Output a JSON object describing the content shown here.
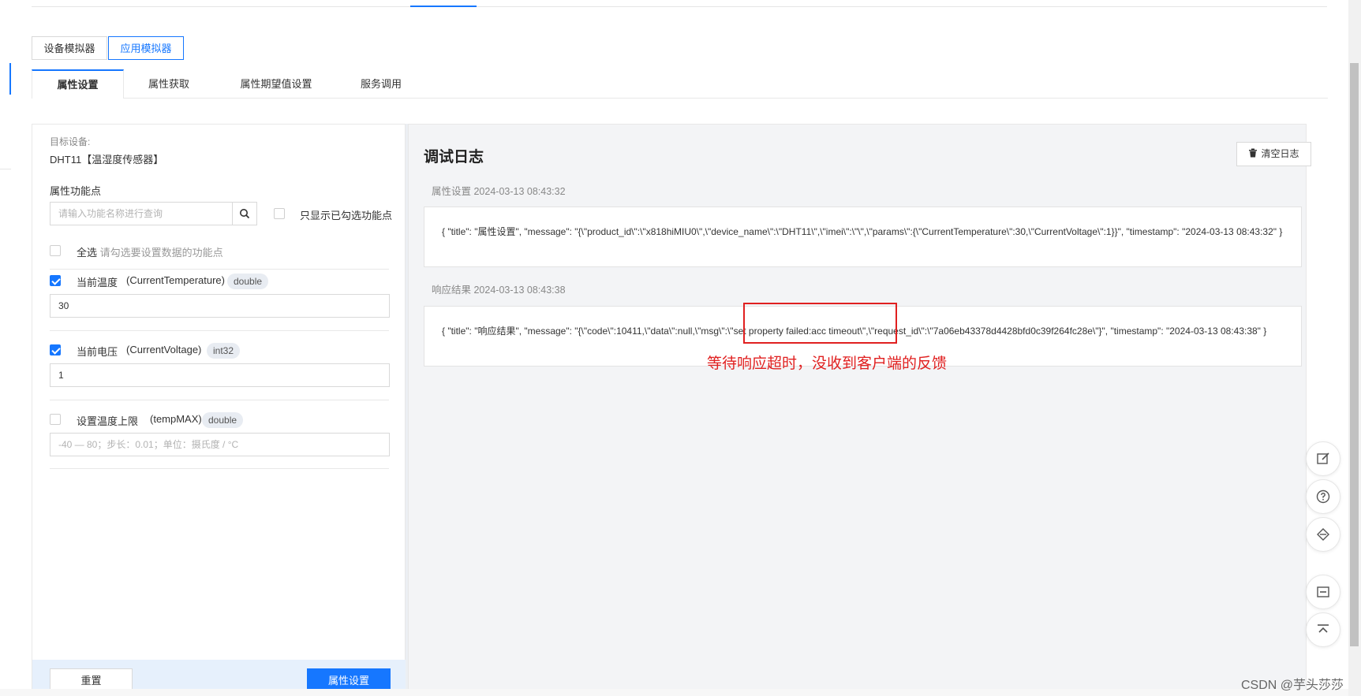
{
  "simulator": {
    "device_label": "设备模拟器",
    "app_label": "应用模拟器"
  },
  "tabs": [
    {
      "label": "属性设置"
    },
    {
      "label": "属性获取"
    },
    {
      "label": "属性期望值设置"
    },
    {
      "label": "服务调用"
    }
  ],
  "left": {
    "target_label": "目标设备:",
    "target_value": "DHT11【温湿度传感器】",
    "feature_label": "属性功能点",
    "search_placeholder": "请输入功能名称进行查询",
    "only_checked_label": "只显示已勾选功能点",
    "select_all_label": "全选",
    "select_all_hint": "请勾选要设置数据的功能点",
    "props": [
      {
        "name": "当前温度",
        "id": "(CurrentTemperature)",
        "type": "double",
        "value": "30",
        "checked": true
      },
      {
        "name": "当前电压",
        "id": "(CurrentVoltage)",
        "type": "int32",
        "value": "1",
        "checked": true
      },
      {
        "name": "设置温度上限",
        "id": "(tempMAX)",
        "type": "double",
        "placeholder": "-40 — 80；步长：0.01；单位：摄氏度 / °C",
        "checked": false
      }
    ],
    "reset_label": "重置",
    "submit_label": "属性设置"
  },
  "log": {
    "title": "调试日志",
    "clear_label": "清空日志",
    "entries": [
      {
        "header": "属性设置 2024-03-13 08:43:32",
        "body": "{ \"title\": \"属性设置\", \"message\": \"{\\\"product_id\\\":\\\"x818hiMIU0\\\",\\\"device_name\\\":\\\"DHT11\\\",\\\"imei\\\":\\\"\\\",\\\"params\\\":{\\\"CurrentTemperature\\\":30,\\\"CurrentVoltage\\\":1}}\", \"timestamp\": \"2024-03-13 08:43:32\" }"
      },
      {
        "header": "响应结果 2024-03-13 08:43:38",
        "body": "{ \"title\": \"响应结果\", \"message\": \"{\\\"code\\\":10411,\\\"data\\\":null,\\\"msg\\\":\\\"set property failed:acc timeout\\\",\\\"request_id\\\":\\\"7a06eb43378d4428bfd0c39f264fc28e\\\"}\", \"timestamp\": \"2024-03-13 08:43:38\" }"
      }
    ]
  },
  "annotation": "等待响应超时，没收到客户端的反馈",
  "watermark": "CSDN @芋头莎莎",
  "icons": [
    "search-icon",
    "trash-icon",
    "edit-icon",
    "help-icon",
    "share-icon",
    "collapse-icon",
    "back-to-top-icon"
  ],
  "colors": {
    "primary": "#1677ff",
    "annotation": "#e02020"
  }
}
